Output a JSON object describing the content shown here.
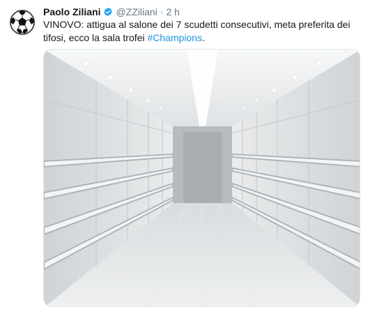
{
  "tweet": {
    "author_name": "Paolo Ziliani",
    "handle": "@ZZiliani",
    "separator": "·",
    "time": "2 h",
    "text_part1": "VINOVO: attigua al salone dei 7 scudetti  consecutivi, meta preferita dei tifosi, ecco la sala trofei ",
    "hashtag": "#Champions",
    "text_part2": "."
  },
  "icons": {
    "avatar": "soccer-ball-icon",
    "verified": "verified-badge-icon"
  },
  "colors": {
    "link": "#1b95e0",
    "secondary_text": "#657786",
    "primary_text": "#14171a",
    "verified": "#1da1f2"
  }
}
